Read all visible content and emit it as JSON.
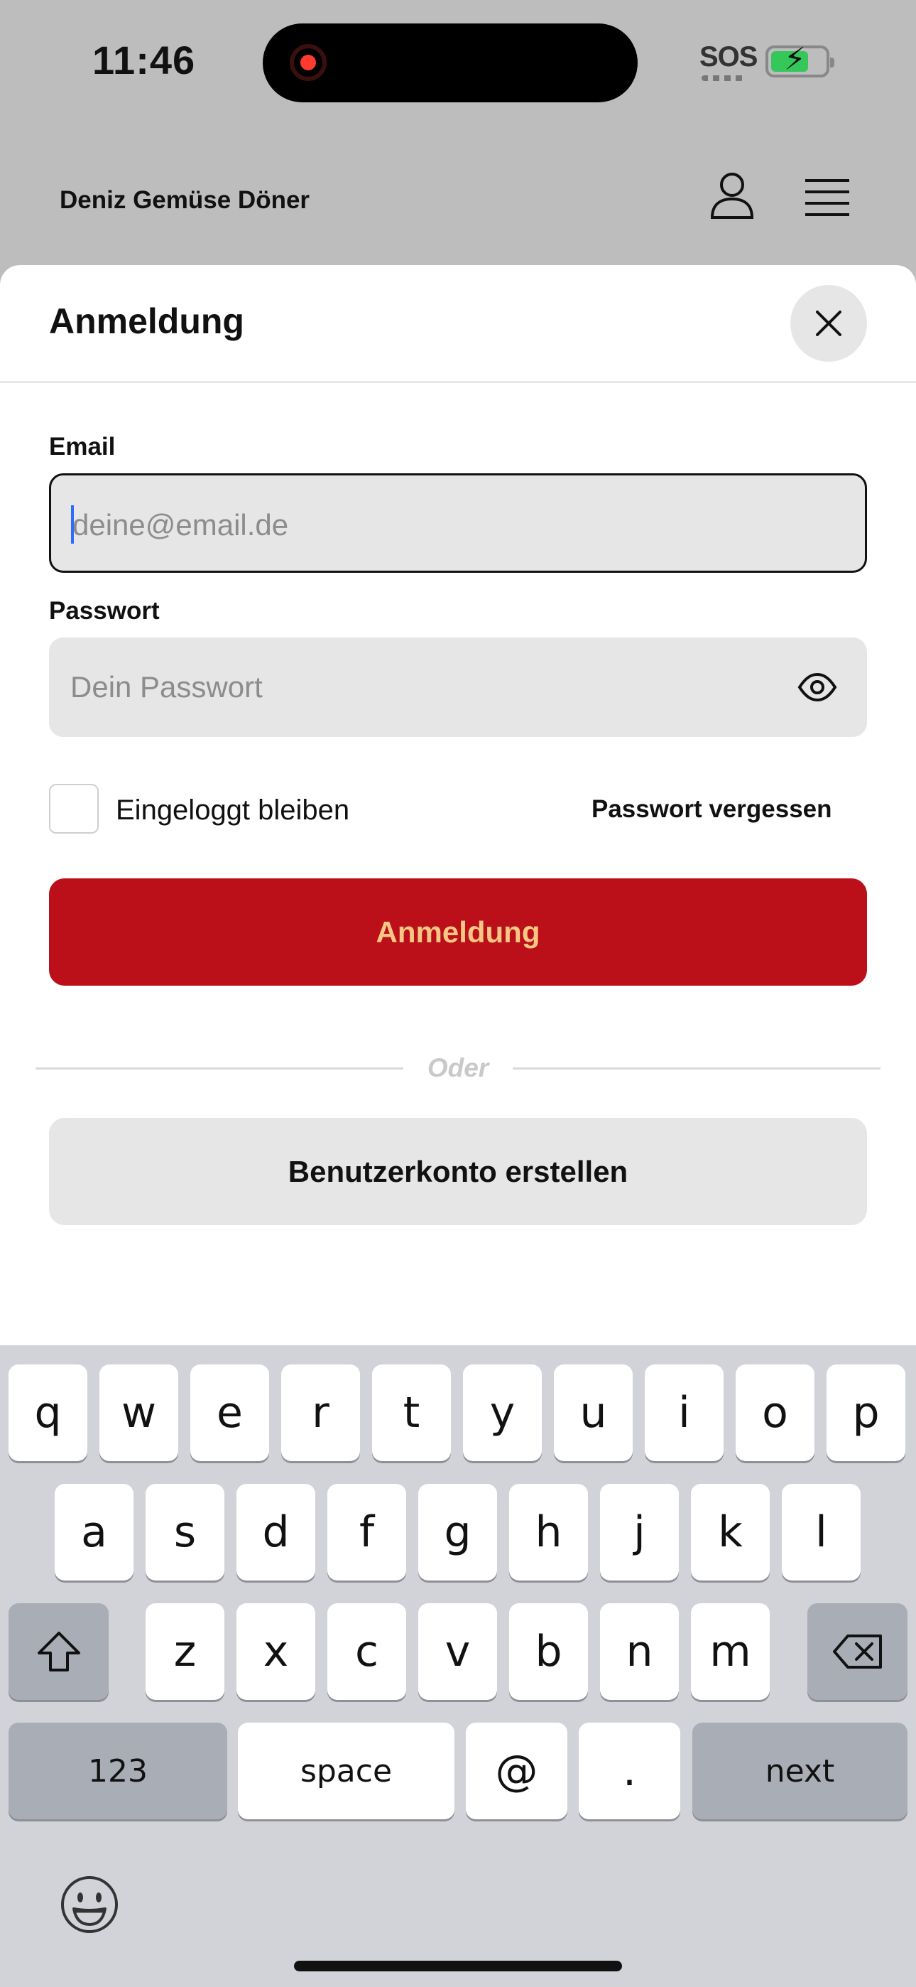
{
  "status_bar": {
    "time": "11:46",
    "sos": "SOS"
  },
  "header": {
    "brand": "Deniz Gemüse Döner"
  },
  "sheet": {
    "title": "Anmeldung",
    "email_label": "Email",
    "email_placeholder": "deine@email.de",
    "password_label": "Passwort",
    "password_placeholder": "Dein Passwort",
    "stay_logged_in": "Eingeloggt bleiben",
    "stay_logged_in_checked": false,
    "forgot_password": "Passwort vergessen",
    "login_button": "Anmeldung",
    "or": "Oder",
    "create_account_button": "Benutzerkonto erstellen"
  },
  "keyboard": {
    "row1": [
      "q",
      "w",
      "e",
      "r",
      "t",
      "y",
      "u",
      "i",
      "o",
      "p"
    ],
    "row2": [
      "a",
      "s",
      "d",
      "f",
      "g",
      "h",
      "j",
      "k",
      "l"
    ],
    "row3": [
      "z",
      "x",
      "c",
      "v",
      "b",
      "n",
      "m"
    ],
    "numbers_key": "123",
    "space_key": "space",
    "at_key": "@",
    "dot_key": ".",
    "next_key": "next"
  },
  "icons": {
    "user": "user-icon",
    "menu": "menu-icon",
    "close": "close-icon",
    "eye": "eye-icon",
    "shift": "shift-icon",
    "backspace": "backspace-icon",
    "emoji": "emoji-icon"
  },
  "colors": {
    "accent": "#bb1019",
    "accent_text": "#f9c785",
    "battery": "#34c759"
  }
}
